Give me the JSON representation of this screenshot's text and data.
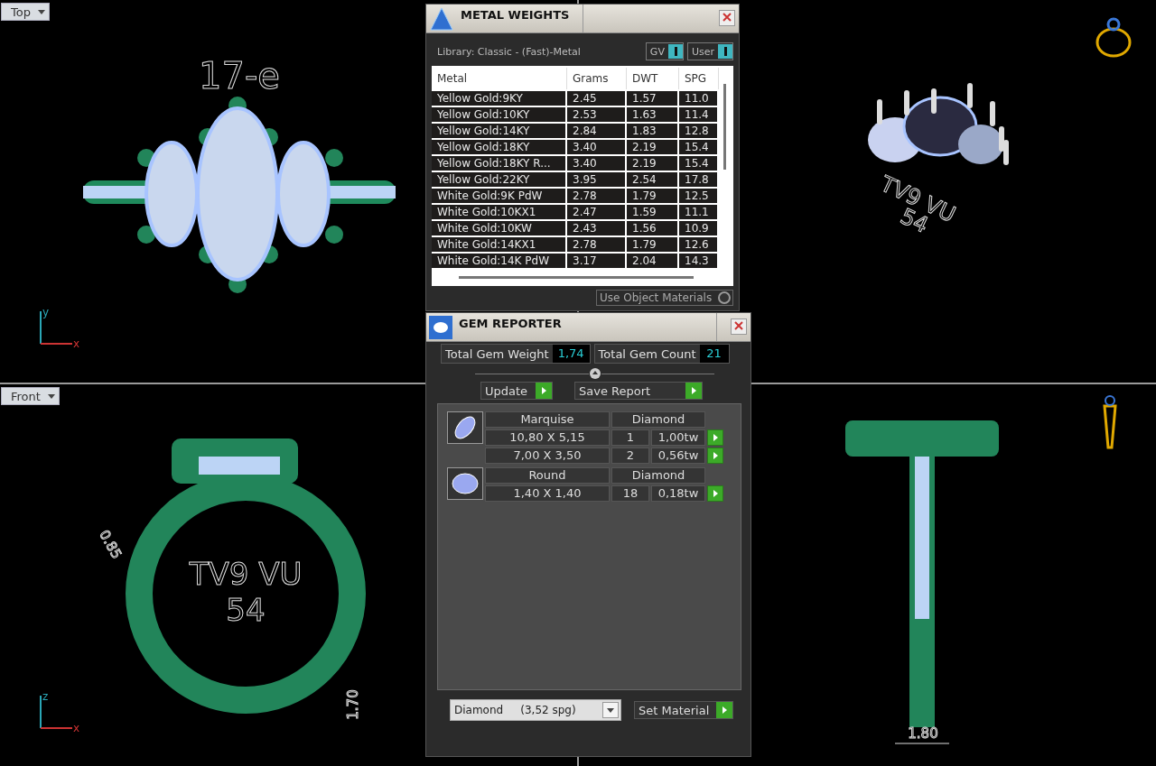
{
  "viewports": [
    {
      "kind": "top",
      "label": "Top",
      "texts": [
        "17-e"
      ],
      "axes": [
        "y",
        "x"
      ]
    },
    {
      "kind": "perspective",
      "texts": [
        "TV9 VU",
        "54"
      ]
    },
    {
      "kind": "front",
      "label": "Front",
      "texts": [
        "TV9 VU",
        "54",
        "0.85",
        "1.70"
      ],
      "axes": [
        "z",
        "x"
      ]
    },
    {
      "kind": "right",
      "texts": [
        "1.80"
      ]
    }
  ],
  "metal_weights": {
    "title": "METAL WEIGHTS",
    "library": "Library: Classic - (Fast)-Metal",
    "toggles": [
      {
        "label": "GV",
        "on": true
      },
      {
        "label": "User",
        "on": true
      }
    ],
    "columns": [
      "Metal",
      "Grams",
      "DWT",
      "SPG"
    ],
    "rows": [
      [
        "Yellow Gold:9KY",
        "2.45",
        "1.57",
        "11.0"
      ],
      [
        "Yellow Gold:10KY",
        "2.53",
        "1.63",
        "11.4"
      ],
      [
        "Yellow Gold:14KY",
        "2.84",
        "1.83",
        "12.8"
      ],
      [
        "Yellow Gold:18KY",
        "3.40",
        "2.19",
        "15.4"
      ],
      [
        "Yellow Gold:18KY R...",
        "3.40",
        "2.19",
        "15.4"
      ],
      [
        "Yellow Gold:22KY",
        "3.95",
        "2.54",
        "17.8"
      ],
      [
        "White Gold:9K PdW",
        "2.78",
        "1.79",
        "12.5"
      ],
      [
        "White Gold:10KX1",
        "2.47",
        "1.59",
        "11.1"
      ],
      [
        "White Gold:10KW",
        "2.43",
        "1.56",
        "10.9"
      ],
      [
        "White Gold:14KX1",
        "2.78",
        "1.79",
        "12.6"
      ],
      [
        "White Gold:14K PdW",
        "3.17",
        "2.04",
        "14.3"
      ]
    ],
    "use_object_materials": {
      "label": "Use Object Materials",
      "on": false
    }
  },
  "gem_reporter": {
    "title": "GEM REPORTER",
    "totals": [
      {
        "label": "Total Gem Weight",
        "value": "1,74"
      },
      {
        "label": "Total Gem Count",
        "value": "21"
      }
    ],
    "buttons": [
      "Update",
      "Save Report"
    ],
    "groups": [
      {
        "kind": "marquise",
        "shape": "Marquise",
        "material": "Diamond",
        "rows": [
          {
            "size": "10,80 X 5,15",
            "count": "1",
            "weight": "1,00tw"
          },
          {
            "size": "7,00 X 3,50",
            "count": "2",
            "weight": "0,56tw"
          }
        ]
      },
      {
        "kind": "round",
        "shape": "Round",
        "material": "Diamond",
        "rows": [
          {
            "size": "1,40 X 1,40",
            "count": "18",
            "weight": "0,18tw"
          }
        ]
      }
    ],
    "material": "Diamond     (3,52 spg)",
    "set_material": "Set Material"
  }
}
